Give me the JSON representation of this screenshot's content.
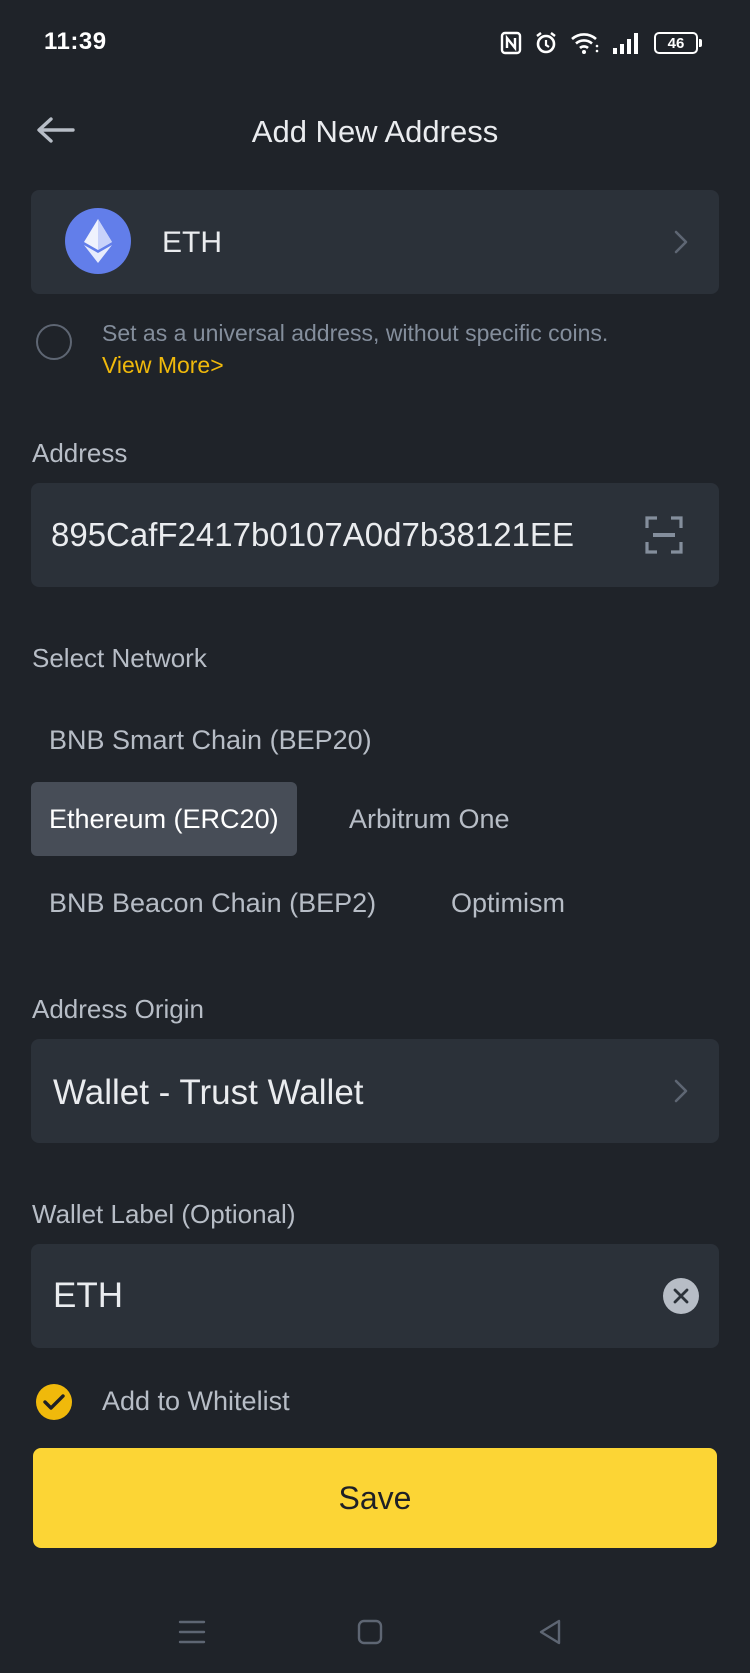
{
  "status_bar": {
    "time": "11:39",
    "battery": "46",
    "icons": [
      "nfc-icon",
      "alarm-icon",
      "wifi-icon",
      "signal-icon",
      "battery-icon"
    ]
  },
  "header": {
    "title": "Add New Address",
    "back_icon": "arrow-left-icon"
  },
  "coin": {
    "name": "ETH",
    "icon": "ethereum-logo-icon"
  },
  "universal": {
    "text": "Set as a universal address, without specific coins.",
    "link": "View More>"
  },
  "address": {
    "label": "Address",
    "value": "895CafF2417b0107A0d7b38121EE"
  },
  "network": {
    "label": "Select Network",
    "options": [
      "BNB Smart Chain (BEP20)",
      "Ethereum (ERC20)",
      "Arbitrum One",
      "BNB Beacon Chain (BEP2)",
      "Optimism"
    ],
    "selected": "Ethereum (ERC20)"
  },
  "origin": {
    "label": "Address Origin",
    "value": "Wallet - Trust Wallet"
  },
  "wallet_label": {
    "label": "Wallet Label (Optional)",
    "value": "ETH"
  },
  "whitelist": {
    "label": "Add to Whitelist",
    "checked": true
  },
  "save": {
    "label": "Save"
  },
  "colors": {
    "background": "#1f2329",
    "card": "#2b3139",
    "accent": "#fcd535",
    "link": "#f0b90b",
    "eth": "#627eea"
  }
}
